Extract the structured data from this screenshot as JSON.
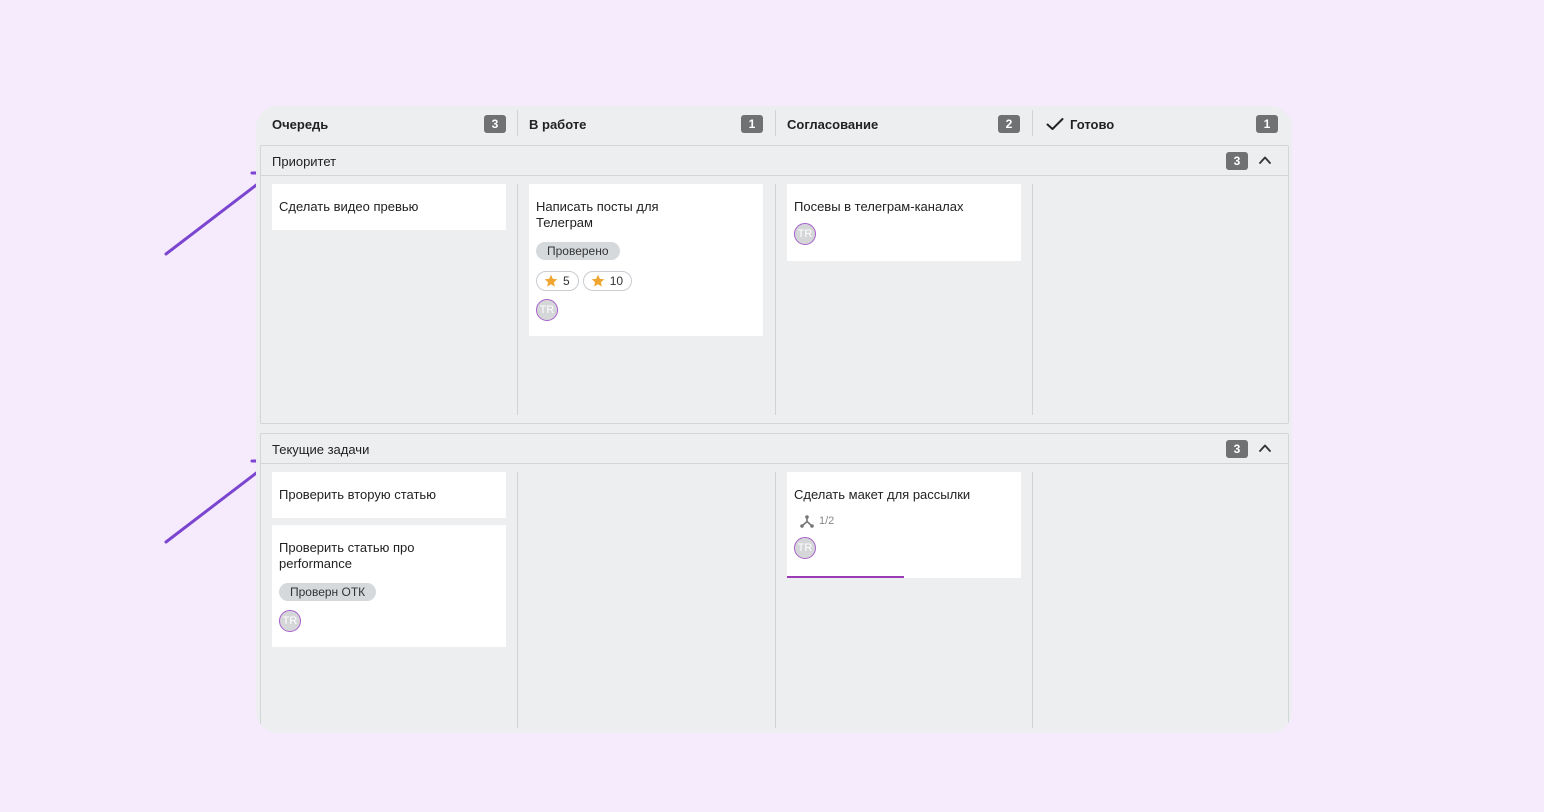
{
  "columns": [
    {
      "title": "Очередь",
      "count": "3"
    },
    {
      "title": "В работе",
      "count": "1"
    },
    {
      "title": "Согласование",
      "count": "2"
    },
    {
      "title": "Готово",
      "count": "1",
      "icon": "check-icon"
    }
  ],
  "swimlanes": [
    {
      "title": "Приоритет",
      "count": "3",
      "cards": {
        "queue": [
          {
            "title": "Сделать видео превью"
          }
        ],
        "in_progress": [
          {
            "title": "Написать посты для Телеграм",
            "tag": "Проверено",
            "stars": [
              "5",
              "10"
            ],
            "avatar": "TR"
          }
        ],
        "review": [
          {
            "title": "Посевы в телеграм-каналах",
            "avatar": "TR"
          }
        ]
      }
    },
    {
      "title": "Текущие задачи",
      "count": "3",
      "cards": {
        "queue": [
          {
            "title": "Проверить вторую статью"
          },
          {
            "title": "Проверить статью про performance",
            "tag": "Проверн ОТК",
            "avatar": "TR"
          }
        ],
        "review": [
          {
            "title": "Сделать макет для рассылки",
            "subtasks": "1/2",
            "avatar": "TR",
            "progress": 0.5
          }
        ]
      }
    }
  ],
  "colors": {
    "background": "#f5ebfd",
    "board": "#eceef0",
    "badge": "#6f7173",
    "accent": "#9c3bb8",
    "arrow": "#7b45cf",
    "star": "#f0a530"
  }
}
